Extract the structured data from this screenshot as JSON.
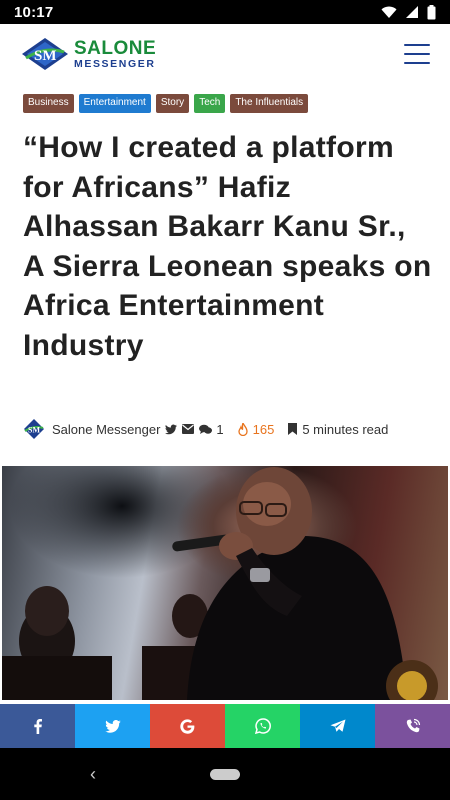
{
  "status_bar": {
    "time": "10:17"
  },
  "header": {
    "logo_line1": "SALONE",
    "logo_line2": "MESSENGER",
    "logo_mark": "SM"
  },
  "tags": [
    {
      "label": "Business",
      "color": "#7b4a3c"
    },
    {
      "label": "Entertainment",
      "color": "#1f7bd0"
    },
    {
      "label": "Story",
      "color": "#7b4a3c"
    },
    {
      "label": "Tech",
      "color": "#3aa64a"
    },
    {
      "label": "The Influentials",
      "color": "#7b4a3c"
    }
  ],
  "article": {
    "title": "“How I created a platform for Africans” Hafiz Alhassan Bakarr Kanu Sr., A Sierra Leonean speaks on Africa Entertainment Industry",
    "author": "Salone Messenger",
    "comments": "1",
    "views": "165",
    "read_time": "5 minutes read"
  },
  "share": [
    {
      "network": "facebook-icon",
      "color": "#3b5998",
      "glyph": "f"
    },
    {
      "network": "twitter-icon",
      "color": "#1da1f2",
      "glyph": ""
    },
    {
      "network": "google-icon",
      "color": "#dd4b39",
      "glyph": "G"
    },
    {
      "network": "whatsapp-icon",
      "color": "#25d366",
      "glyph": ""
    },
    {
      "network": "telegram-icon",
      "color": "#0088cc",
      "glyph": ""
    },
    {
      "network": "viber-icon",
      "color": "#7b519d",
      "glyph": ""
    }
  ]
}
